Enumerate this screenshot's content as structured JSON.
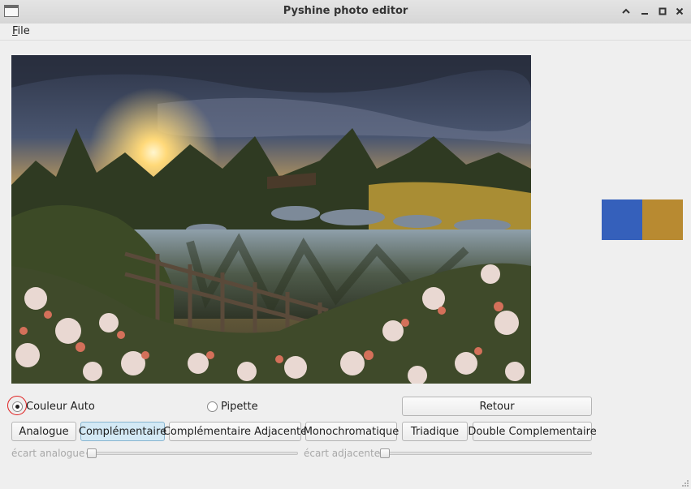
{
  "window": {
    "title": "Pyshine photo editor",
    "controls": [
      "minimize-icon",
      "maximize-icon",
      "close-icon",
      "chevron-up-icon"
    ]
  },
  "menu": {
    "file_first": "F",
    "file_rest": "ile"
  },
  "image": {
    "description_icon": "photo-icon"
  },
  "palette": {
    "colors": [
      "#3560bb",
      "#b88a31"
    ]
  },
  "mode": {
    "auto_label": "Couleur Auto",
    "auto_checked": true,
    "pipette_label": "Pipette",
    "pipette_checked": false
  },
  "buttons": {
    "retour": "Retour",
    "analogue": "Analogue",
    "complementaire": "Complémentaire",
    "complementaire_adjacente": "Complémentaire Adjacente",
    "monochromatique": "Monochromatique",
    "triadique": "Triadique",
    "double_complementaire": "Double Complementaire",
    "active": "complementaire"
  },
  "sliders": {
    "analogue_label": "écart analogue",
    "analogue_value": 0,
    "adjacente_label": "écart adjacente",
    "adjacente_value": 0
  }
}
